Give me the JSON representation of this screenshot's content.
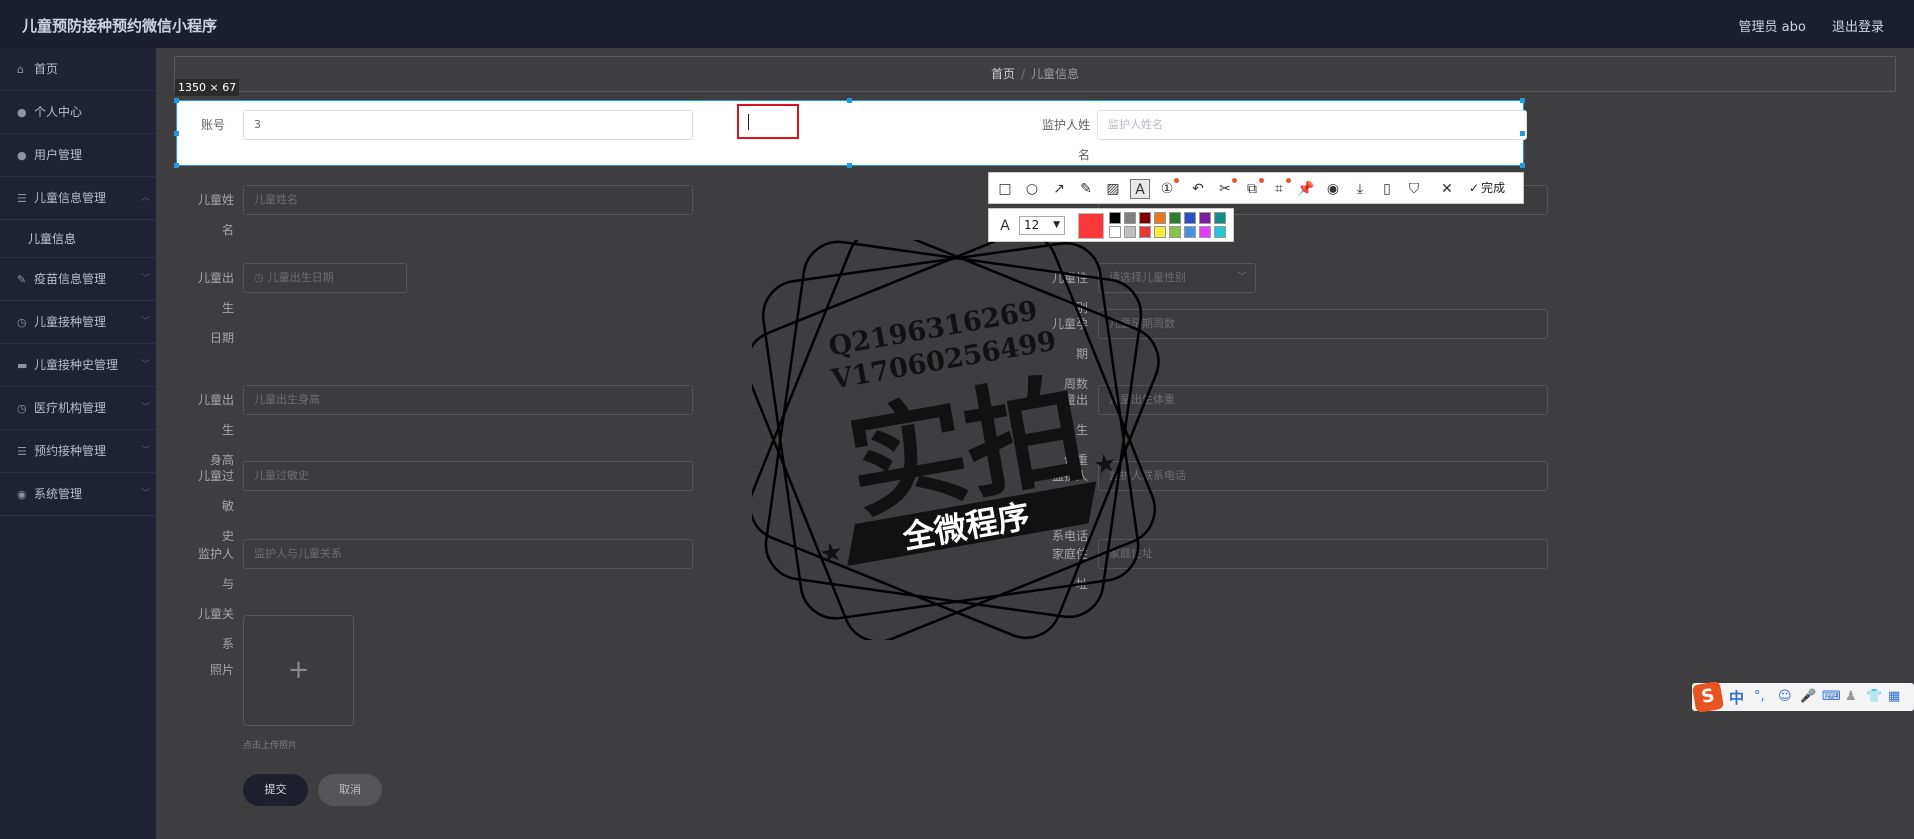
{
  "header": {
    "app_title": "儿童预防接种预约微信小程序",
    "user": "管理员 abo",
    "logout": "退出登录"
  },
  "sidebar": {
    "items": [
      {
        "label": "首页",
        "icon": "home-icon"
      },
      {
        "label": "个人中心",
        "icon": "user-icon"
      },
      {
        "label": "用户管理",
        "icon": "user-icon"
      },
      {
        "label": "儿童信息管理",
        "icon": "list-icon"
      },
      {
        "label": "疫苗信息管理",
        "icon": "edit-icon"
      },
      {
        "label": "儿童接种管理",
        "icon": "clock-icon"
      },
      {
        "label": "儿童接种史管理",
        "icon": "chat-icon"
      },
      {
        "label": "医疗机构管理",
        "icon": "clock-icon"
      },
      {
        "label": "预约接种管理",
        "icon": "list-icon"
      },
      {
        "label": "系统管理",
        "icon": "settings-icon"
      }
    ],
    "sub_item": "儿童信息"
  },
  "breadcrumb": {
    "home": "首页",
    "separator": "/",
    "current": "儿童信息"
  },
  "form": {
    "account_label": "账号",
    "account_value": "3",
    "guardian_name_label_1": "监护人姓",
    "guardian_name_label_2": "名",
    "guardian_name_placeholder": "监护人姓名",
    "child_name_label": "儿童姓名",
    "child_name_placeholder": "儿童姓名",
    "birth_date_label_1": "儿童出生",
    "birth_date_label_2": "日期",
    "birth_date_placeholder": "儿童出生日期",
    "gender_label": "儿童性别",
    "gender_placeholder": "请选择儿童性别",
    "gestation_label_1": "儿童孕期",
    "gestation_label_2": "周数",
    "gestation_placeholder": "儿童孕期周数",
    "height_label_1": "儿童出生",
    "height_label_2": "身高",
    "height_placeholder": "儿童出生身高",
    "weight_label_1": "儿童出生",
    "weight_label_2": "体重",
    "weight_placeholder": "儿童出生体重",
    "allergy_label_1": "儿童过敏",
    "allergy_label_2": "史",
    "allergy_placeholder": "儿童过敏史",
    "guardian_phone_label_1": "监护人联",
    "guardian_phone_label_2": "系电话",
    "guardian_phone_placeholder": "监护人联系电话",
    "relation_label_1": "监护人与",
    "relation_label_2": "儿童关系",
    "relation_placeholder": "监护人与儿童关系",
    "address_label": "家庭住址",
    "address_placeholder": "家庭住址",
    "photo_label": "照片",
    "upload_tip": "点击上传照片",
    "submit": "提交",
    "cancel": "取消"
  },
  "screenshot_tool": {
    "selection_size": "1350 × 67",
    "done": "完成",
    "font_size": "12",
    "current_color": "#fb3838",
    "palette": [
      "#000000",
      "#808080",
      "#800000",
      "#e87722",
      "#2e7d32",
      "#2a4fc9",
      "#7b1fa2",
      "#138c8c",
      "#ffffff",
      "#c0c0c0",
      "#e53935",
      "#ffeb3b",
      "#8bc34a",
      "#4a90e2",
      "#e040fb",
      "#26c6da"
    ]
  },
  "watermark": {
    "line1": "Q2196316269",
    "line2": "V17060256499",
    "main": "实拍",
    "ribbon": "全微程序"
  },
  "ime": {
    "logo": "S",
    "mode": "中"
  }
}
